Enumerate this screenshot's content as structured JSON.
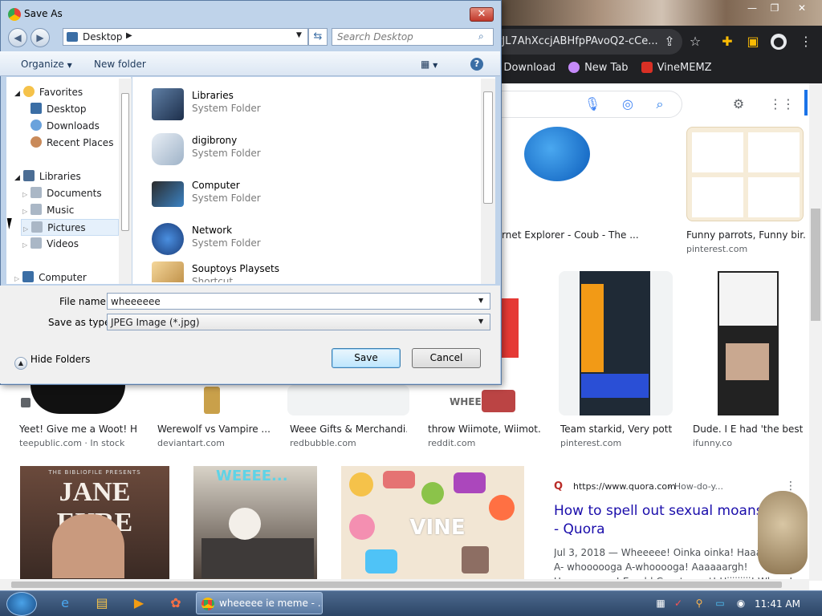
{
  "browser": {
    "omnibox_text": "rJL7AhXccjABHfpPAvoQ2-cCe...",
    "bookmarks": [
      "or Download",
      "New Tab",
      "VineMEMZ"
    ]
  },
  "results_row1": [
    {
      "caption": "rnet Explorer - Coub - The ...",
      "source": ""
    },
    {
      "caption": "Funny parrots, Funny bir...",
      "source": "pinterest.com"
    }
  ],
  "results_row2": [
    {
      "caption": "Yeet! Give me a Woot! H...",
      "source": "teepublic.com · In stock"
    },
    {
      "caption": "Werewolf vs Vampire ...",
      "source": "deviantart.com"
    },
    {
      "caption": "Weee Gifts & Merchandi...",
      "source": "redbubble.com"
    },
    {
      "caption": "throw Wiimote, Wiimot...",
      "source": "reddit.com"
    },
    {
      "caption": "Team starkid, Very pott...",
      "source": "pinterest.com"
    },
    {
      "caption": "Dude. I E had 'the best ...",
      "source": "ifunny.co"
    }
  ],
  "row3": {
    "jane": "JANE EYRE",
    "jane_top": "THE BIBLIOFILE PRESENTS",
    "weee": "WEEEE...",
    "vine": "VINE",
    "quora_url": "https://www.quora.com",
    "quora_path": "› How-do-y...",
    "quora_title": "How to spell out sexual moans - Quora",
    "quora_snippet": "Jul 3, 2018 — Wheeeee! Oinka oinka! Haaaaaa... A- whoooooga A-whooooga! Aaaaaargh! Unnnnnnnnn! Eembl Grunt grunt! Hiiiiiiiii! Where! D"
  },
  "whee_label": "WHEE",
  "dialog": {
    "title": "Save As",
    "address": "Desktop",
    "search_placeholder": "Search Desktop",
    "organize": "Organize",
    "new_folder": "New folder",
    "tree": {
      "favorites": "Favorites",
      "fav_items": [
        "Desktop",
        "Downloads",
        "Recent Places"
      ],
      "libraries": "Libraries",
      "lib_items": [
        "Documents",
        "Music",
        "Pictures",
        "Videos"
      ],
      "computer": "Computer"
    },
    "files": [
      {
        "name": "Libraries",
        "type": "System Folder"
      },
      {
        "name": "digibrony",
        "type": "System Folder"
      },
      {
        "name": "Computer",
        "type": "System Folder"
      },
      {
        "name": "Network",
        "type": "System Folder"
      },
      {
        "name": "Souptoys Playsets",
        "type": "Shortcut"
      }
    ],
    "filename_label": "File name:",
    "filename_value": "wheeeeee",
    "savetype_label": "Save as type:",
    "savetype_value": "JPEG Image (*.jpg)",
    "hide_folders": "Hide Folders",
    "save": "Save",
    "cancel": "Cancel"
  },
  "taskbar": {
    "chrome_task": "wheeeee ie meme - ...",
    "clock": "11:41 AM"
  }
}
